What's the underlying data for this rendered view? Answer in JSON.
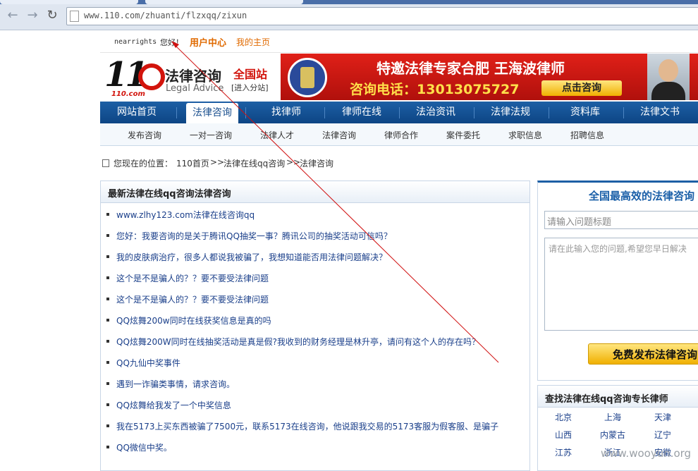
{
  "browser": {
    "url": "www.110.com/zhuanti/flzxqq/zixun"
  },
  "topbar": {
    "username": "nearrights",
    "greeting": "您好！",
    "user_center": "用户中心",
    "my_home": "我的主页"
  },
  "logo": {
    "number": "11",
    "domain": "110.com",
    "cn": "法律咨询",
    "en": "Legal Advice",
    "station": "全国站",
    "enter": "[进入分站]"
  },
  "banner": {
    "title": "特邀法律专家合肥  王海波律师",
    "phone": "咨询电话：13013075727",
    "button": "点击咨询"
  },
  "mainnav": [
    "网站首页",
    "法律咨询",
    "找律师",
    "律师在线",
    "法治资讯",
    "法律法规",
    "资料库",
    "法律文书"
  ],
  "subnav": [
    "发布咨询",
    "一对一咨询",
    "法律人才",
    "法律咨询",
    "律师合作",
    "案件委托",
    "求职信息",
    "招聘信息"
  ],
  "breadcrumb": {
    "label": "您现在的位置：",
    "items": [
      "110首页",
      "法律在线qq咨询",
      "法律咨询"
    ],
    "sep": ">>"
  },
  "left": {
    "title": "最新法律在线qq咨询法律咨询",
    "items": [
      "www.zlhy123.com法律在线咨询qq",
      "您好：我要咨询的是关于腾讯QQ抽奖一事？腾讯公司的抽奖活动可信吗？",
      "我的皮肤病治疗，很多人都说我被骗了，我想知道能否用法律问题解决？",
      "这个是不是骗人的？？要不要受法律问题",
      "这个是不是骗人的？？要不要受法律问题",
      "QQ炫舞200w同时在线获奖信息是真的吗",
      "QQ炫舞200W同时在线抽奖活动是真是假?我收到的财务经理是林升亭，请问有这个人的存在吗？",
      "QQ九仙中奖事件",
      "遇到一诈骗类事情，请求咨询。",
      "QQ炫舞给我发了一个中奖信息",
      "我在5173上买东西被骗了7500元，联系5173在线咨询，他说跟我交易的5173客服为假客服、是骗子",
      "QQ微信中奖。"
    ]
  },
  "right": {
    "title": "全国最高效的法律咨询",
    "title_placeholder": "请输入问题标题",
    "question_placeholder": "请在此输入您的问题,希望您早日解决",
    "publish": "免费发布法律咨询"
  },
  "right2": {
    "title": "查找法律在线qq咨询专长律师",
    "regions": [
      "北京",
      "上海",
      "天津",
      "山西",
      "内蒙古",
      "辽宁",
      "江苏",
      "浙江",
      "安徽"
    ]
  },
  "watermark": "www.wooyun.org"
}
